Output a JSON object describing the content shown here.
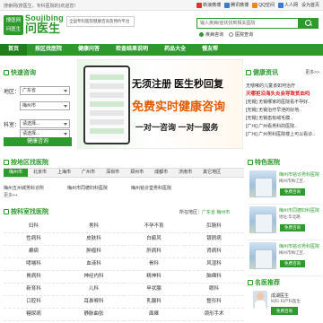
{
  "topbar": {
    "welcome": "搜索网(搜医生，专科医院的)欢迎您！",
    "links": [
      "新浪微博",
      "腾讯微博",
      "QQ空间",
      "人人网",
      "设为首页"
    ]
  },
  "header": {
    "logo_box": "搜医网",
    "logo_box2": "问医生",
    "logo_en": "Soujibing",
    "logo_cn": "问医生",
    "slogan": "全国专科医院健康咨询及预约平台",
    "search_placeholder": "输入疾病/症状找到相关医院",
    "radio_labels": [
      "疾病咨询",
      "医院查询"
    ]
  },
  "nav": [
    "首页",
    "按区找医院",
    "健康问答",
    "检查结果说明",
    "药品大全",
    "慢友帮"
  ],
  "consult": {
    "title": "快速咨询",
    "region_label": "地区：",
    "region_value": "广东省",
    "city_value": "梅州市",
    "dept_label": "科室：",
    "dept_value": "请选择...",
    "dept_value2": "请选择...",
    "button": "健康咨询"
  },
  "banner": {
    "line1": "无须注册  医生秒回复",
    "line2": "免费实时健康咨询",
    "line3": "一对一咨询  一对一服务"
  },
  "news": {
    "title": "健康资讯",
    "more": "更多>>",
    "items": [
      "无喘哮的儿童该如何治疗",
      "天哪拒沿海头炎会导致贫血吗",
      "[无锡] 无锡哪家的医院看不孕好..",
      "[无锡] 无锡治疗早泄的好地..",
      "[无锡] 无锡患有绒毛膜...",
      "[广州] 广州看男科的医院..",
      "[广州] 广州男科医院楼上可以看诊.."
    ]
  },
  "meizhou": {
    "title": "按地区找医院",
    "cities": [
      "梅州市",
      "北京市",
      "上海市",
      "广州市",
      "深圳市",
      "郑州市",
      "成都市",
      "济南市",
      "其它地区"
    ],
    "hospitals": [
      "梅州五州城男科诊所",
      "梅州市同德妇科医院",
      "梅州铭诊堂男科医院"
    ],
    "more": "更多++"
  },
  "departments": {
    "title": "按科室找医院",
    "location_prefix": "所在地区：",
    "location_value": "广东省 梅州市",
    "items": [
      "妇科",
      "男科",
      "不孕不育",
      "肛肠科",
      "性病科",
      "皮肤科",
      "白癜风",
      "银屑病",
      "癫痫",
      "肿瘤科",
      "肝病科",
      "肾病科",
      "哮喘科",
      "血液科",
      "骨科",
      "风湿科",
      "胃病科",
      "神经内科",
      "精神科",
      "脑瘫科",
      "新育科",
      "儿科",
      "甲状腺",
      "眼科",
      "口腔科",
      "耳鼻喉科",
      "乳腺科",
      "整形科",
      "糖尿病",
      "静脉曲张",
      "面瘫",
      "颈形手术"
    ]
  },
  "featured": {
    "title": "特色医院",
    "hospitals": [
      {
        "name": "梅州市铭诊男科医院",
        "sub": "梅州市梅江区..",
        "btn": "免费咨询"
      },
      {
        "name": "梅州市同德妇科医院",
        "sub": "地址:华北路",
        "btn": "免费咨询"
      },
      {
        "name": "梅州市铭诊男科医院",
        "sub": "梅州市梅江区..",
        "btn": "免费咨询"
      }
    ]
  },
  "expert": {
    "title": "名医推荐",
    "name": "成湖医生",
    "sub": "妇科·妇产科医生",
    "btn": "免费咨询"
  }
}
